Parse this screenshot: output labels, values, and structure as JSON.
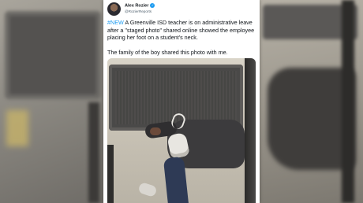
{
  "tweet": {
    "author_name": "Alex Rozier",
    "author_handle": "@RozierReports",
    "verified_symbol": "✓",
    "hashtag": "#NEW",
    "body": " A Greenville ISD teacher is on administrative leave after a \"staged photo\" shared online showed the employee placing her foot on a student's neck.",
    "body2": "The family of the boy shared this photo with me."
  },
  "colors": {
    "link": "#1d9bf0",
    "text": "#0f1419",
    "muted": "#536471"
  }
}
